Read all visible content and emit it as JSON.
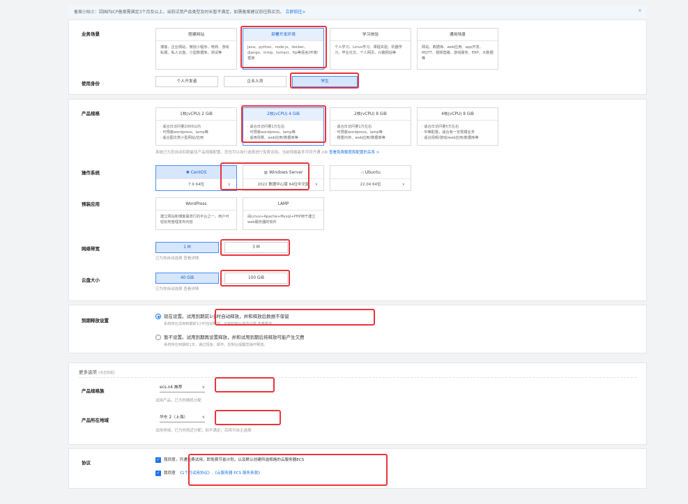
{
  "notice": {
    "text": "备案小贴士：因国内ICP备案需满足3个月及以上，当前试用产品类型及时长暂不满足，如需备案建议前往购买页。",
    "link": "立即前往>",
    "close": "x"
  },
  "scenario": {
    "label": "业务场景",
    "cards": [
      {
        "title": "搭建网站",
        "desc": "博客、企业网站、微信小程序、电商、游戏私服、私人云盘、小型数据库、测试等"
      },
      {
        "title": "部署开发环境",
        "desc": "Java、python、node.js、docker、django、lnmp、tomact、ftp等语言/环境/框架"
      },
      {
        "title": "学习体验",
        "desc": "个人学习、Linux学习、课程实验、机器学习、毕业论文、个人网页、兴趣网站等"
      },
      {
        "title": "通用场景",
        "desc": "网站、数据库、web应用、app开发、MQTT、视频直播、游戏服务、ERP、大数据等"
      }
    ]
  },
  "identity": {
    "label": "使用身份",
    "options": [
      "个人开发者",
      "企业人员",
      "学生"
    ]
  },
  "spec": {
    "label": "产品规格",
    "cards": [
      {
        "title": "1核(vCPU) 2 GiB",
        "desc": "· 适合日访问量2000以内\n· 可预装wordpress、lamp等\n· 适合图文类小型网站/应用"
      },
      {
        "title": "2核(vCPU) 4 GiB",
        "desc": "· 适合日访问量1万左右\n· 可预装wordpress、lamp等\n· 适用场景、web应用/数据库等"
      },
      {
        "title": "2核(vCPU) 8 GiB",
        "desc": "· 适合日访问量1万左右\n· 可预装wordpress、lamp等\n· 侧重内存、web应用/数据库等"
      },
      {
        "title": "4核(vCPU) 8 GiB",
        "desc": "· 适合日访问量5万左右\n· 中等配置，适合有一定规模业务\n· 适合视频/游戏/web应用/数据库等"
      }
    ],
    "hint": "系统已为您自动匹配最佳产品规格配置，您也可以自行选择进行免费试用。当前规格最多可同开通 2台",
    "hint_link": "查看免费额度和配置的关系 >"
  },
  "os": {
    "label": "操作系统",
    "options": [
      {
        "name": "CentOS",
        "version": "7.9 64位"
      },
      {
        "name": "Windows Server",
        "version": "2022 数据中心版 64位中文版"
      },
      {
        "name": "Ubuntu",
        "version": "22.04 64位"
      }
    ]
  },
  "apps": {
    "label": "预装应用",
    "cards": [
      {
        "title": "WordPress",
        "desc": "建立网站和博客最流行的平台之一，用户可轻松地管理发布内容"
      },
      {
        "title": "LAMP",
        "desc": "由Linux+Apache+Mysql+PHP用于建立web服务器的软件"
      }
    ]
  },
  "bandwidth": {
    "label": "网络带宽",
    "options": [
      "1 M",
      "3 M"
    ],
    "hint": "已为你自动选择 查看详情"
  },
  "disk": {
    "label": "云盘大小",
    "options": [
      "40 GiB",
      "100 GiB"
    ],
    "hint": "已为你自动选择 查看详情"
  },
  "release": {
    "label": "到期释放设置",
    "opt1": "现在设置。试用到期前1小时自动释放，并和释放后数据不保留",
    "opt1_sub": "系统将在试用到期前1小时自动释放，可到控制台修改设置 查看释放",
    "opt2": "暂不设置。试用到期再设置释放，并和试用到期后将释放可能产生欠费",
    "opt2_sub": "系统将在到期前1天，通过短信、邮件、控制台提醒您操作释放。"
  },
  "more": {
    "label": "更多选项",
    "toggle": "(点击收起)"
  },
  "family": {
    "label": "产品规格族",
    "value": "ecs.n4 推荐",
    "hint": "试用产品，已为你随机分配"
  },
  "region": {
    "label": "产品所在地域",
    "value": "华东 2（上海）",
    "hint": "试用地域，已为你就近分配，如不满足，后续可自主选择"
  },
  "agreement": {
    "label": "协议",
    "line1": "我同意，开通免费试用，即免费节省计划，以及默认创建所选规格的云服务器ECS",
    "line2_prefix": "我同意",
    "line2_links": "《1个月试用协议》,《云服务器 ECS 服务条款》"
  },
  "icons": {
    "check": "✓",
    "chevron": "∨"
  }
}
